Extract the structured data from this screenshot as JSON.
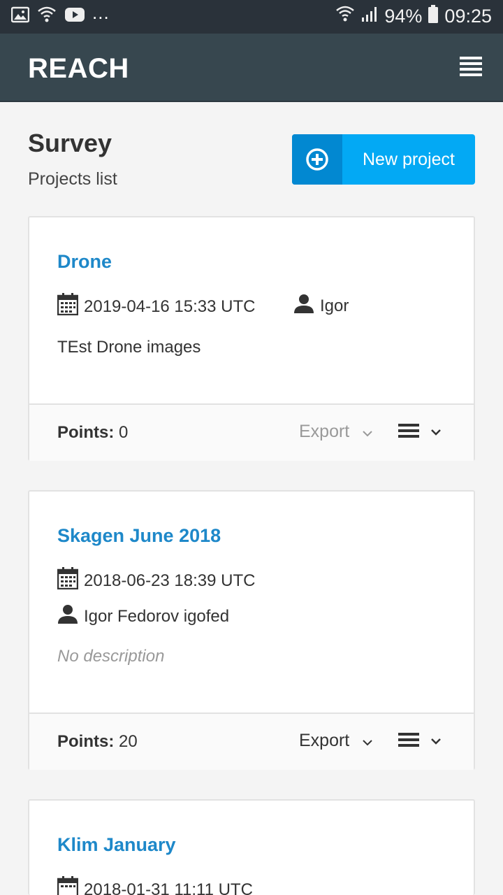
{
  "status_bar": {
    "left_icons": [
      "image-icon",
      "wifi-question-icon",
      "youtube-icon"
    ],
    "overflow": "...",
    "battery": "94%",
    "time": "09:25"
  },
  "app": {
    "brand": "REACH",
    "menu_icon": "hamburger-menu-icon"
  },
  "page": {
    "title": "Survey",
    "subtitle": "Projects list",
    "new_button_label": "New project"
  },
  "projects": [
    {
      "title": "Drone",
      "date": "2019-04-16 15:33 UTC",
      "user": "Igor",
      "description": "TEst Drone images",
      "points_label": "Points:",
      "points_value": "0",
      "export_label": "Export",
      "export_enabled": false
    },
    {
      "title": "Skagen June 2018",
      "date": "2018-06-23 18:39 UTC",
      "user": "Igor Fedorov igofed",
      "description": "No description",
      "points_label": "Points:",
      "points_value": "20",
      "export_label": "Export",
      "export_enabled": true
    },
    {
      "title": "Klim January",
      "date": "2018-01-31 11:11 UTC"
    }
  ],
  "colors": {
    "appbar": "#37474f",
    "accent": "#03a9f4",
    "link": "#1e88c9"
  }
}
